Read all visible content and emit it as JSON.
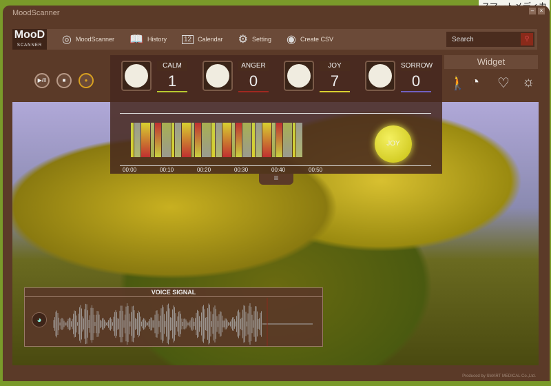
{
  "background_text": "スマートメディカ",
  "window": {
    "title": "MoodScanner",
    "minimize": "–",
    "close": "×"
  },
  "logo": {
    "top": "MooD",
    "bottom": "SCANNER"
  },
  "nav": [
    {
      "label": "MoodScanner",
      "icon": "rings-icon"
    },
    {
      "label": "History",
      "icon": "book-icon"
    },
    {
      "label": "Calendar",
      "icon": "calendar-icon",
      "glyph": "12"
    },
    {
      "label": "Setting",
      "icon": "gears-icon"
    },
    {
      "label": "Create CSV",
      "icon": "csv-icon"
    }
  ],
  "search": {
    "placeholder": "Search"
  },
  "controls": {
    "play_pause": "▶/II",
    "stop": "■",
    "record": "●"
  },
  "meters": [
    {
      "name": "CALM",
      "value": "1",
      "color": "#b8c830"
    },
    {
      "name": "ANGER",
      "value": "0",
      "color": "#a02820"
    },
    {
      "name": "JOY",
      "value": "7",
      "color": "#d8d030"
    },
    {
      "name": "SORROW",
      "value": "0",
      "color": "#7060c0"
    }
  ],
  "timeline": {
    "ticks": [
      "00:00",
      "00:10",
      "00:20",
      "00:30",
      "00:40",
      "00:50"
    ],
    "current": "JOY"
  },
  "widget": {
    "title": "Widget",
    "icons": [
      "person-icon",
      "pie-chart-icon",
      "heart-icon",
      "sun-icon"
    ]
  },
  "voice_signal": {
    "title": "VOICE SIGNAL"
  },
  "footer": "Produced by SMART MEDICAL Co.,Ltd."
}
